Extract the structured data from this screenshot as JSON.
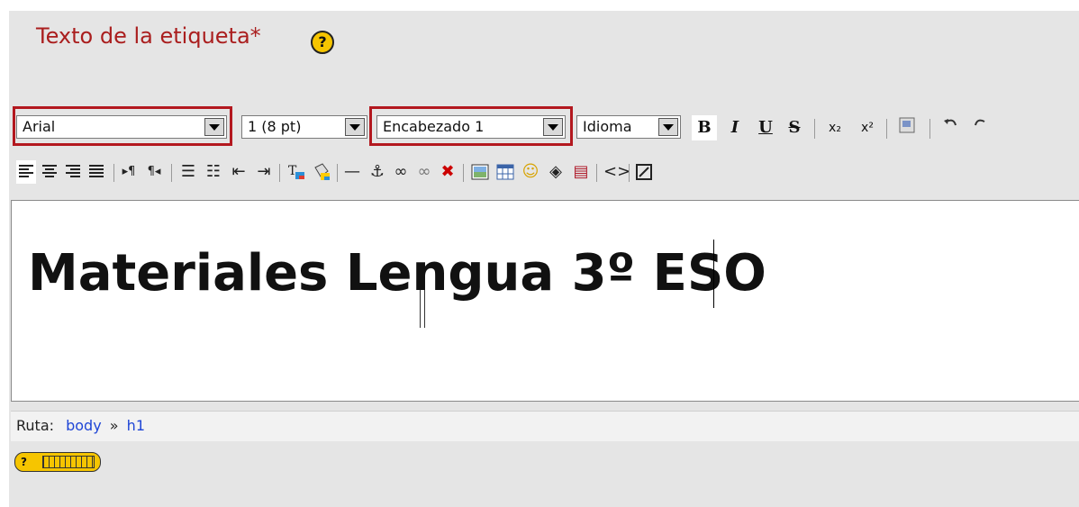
{
  "field": {
    "label": "Texto de la etiqueta*",
    "help_icon": "?"
  },
  "toolbar": {
    "font_family": "Arial",
    "font_size": "1 (8 pt)",
    "format": "Encabezado 1",
    "language": "Idioma",
    "bold": "B",
    "italic": "I",
    "underline": "U",
    "strike": "S",
    "subscript": "x₂",
    "superscript": "x²",
    "icons_row2": [
      "align-left-icon",
      "align-center-icon",
      "align-right-icon",
      "justify-icon",
      "ltr-icon",
      "rtl-icon",
      "numbered-list-icon",
      "bulleted-list-icon",
      "outdent-icon",
      "indent-icon",
      "text-color-icon",
      "background-color-icon",
      "horizontal-rule-icon",
      "anchor-icon",
      "link-icon",
      "unlink-icon",
      "nolink-icon",
      "image-icon",
      "table-icon",
      "smiley-icon",
      "special-char-icon",
      "search-replace-icon",
      "html-source-icon",
      "fullscreen-icon"
    ]
  },
  "editor": {
    "content": "Materiales Lengua 3º ESO"
  },
  "path": {
    "label": "Ruta:",
    "items": [
      "body",
      "h1"
    ],
    "separator": "»"
  },
  "help_button": {
    "label": "?"
  },
  "colors": {
    "accent": "#b3181f",
    "label_red": "#aa1e1e",
    "link": "#1f46d6"
  }
}
